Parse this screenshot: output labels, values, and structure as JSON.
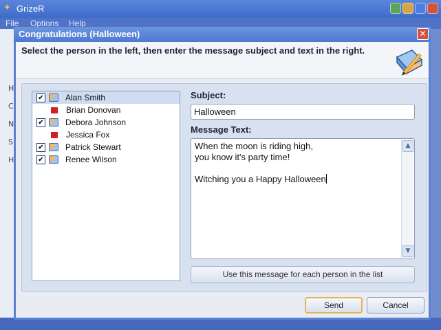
{
  "app": {
    "title": "GrizeR",
    "menu": [
      "File",
      "Options",
      "Help"
    ],
    "side_letters": [
      "H",
      "C",
      "N",
      "S",
      "H"
    ]
  },
  "dialog": {
    "title": "Congratulations (Halloween)",
    "instruction": "Select the person in the left, then enter the message subject and text in the right.",
    "close_glyph": "✕"
  },
  "people": [
    {
      "name": "Alan Smith",
      "checked": true,
      "marker": false,
      "envelope": true,
      "selected": true
    },
    {
      "name": "Brian Donovan",
      "checked": false,
      "marker": true,
      "envelope": false,
      "selected": false
    },
    {
      "name": "Debora Johnson",
      "checked": true,
      "marker": false,
      "envelope": true,
      "selected": false
    },
    {
      "name": "Jessica Fox",
      "checked": false,
      "marker": true,
      "envelope": false,
      "selected": false
    },
    {
      "name": "Patrick Stewart",
      "checked": true,
      "marker": false,
      "envelope": true,
      "selected": false
    },
    {
      "name": "Renee Wilson",
      "checked": true,
      "marker": false,
      "envelope": true,
      "selected": false
    }
  ],
  "form": {
    "subject_label": "Subject:",
    "subject_value": "Halloween",
    "message_label": "Message Text:",
    "message_value": "When the moon is riding high,\nyou know it's party time!\n\nWitching you a Happy Halloween",
    "use_for_all_label": "Use this message for each person in the list"
  },
  "buttons": {
    "send": "Send",
    "cancel": "Cancel"
  },
  "icons": {
    "check": "✔",
    "scroll_up": "▲",
    "scroll_down": "▼"
  },
  "colors": {
    "marker_red": "#d22020",
    "default_button_border": "#e3b655"
  }
}
